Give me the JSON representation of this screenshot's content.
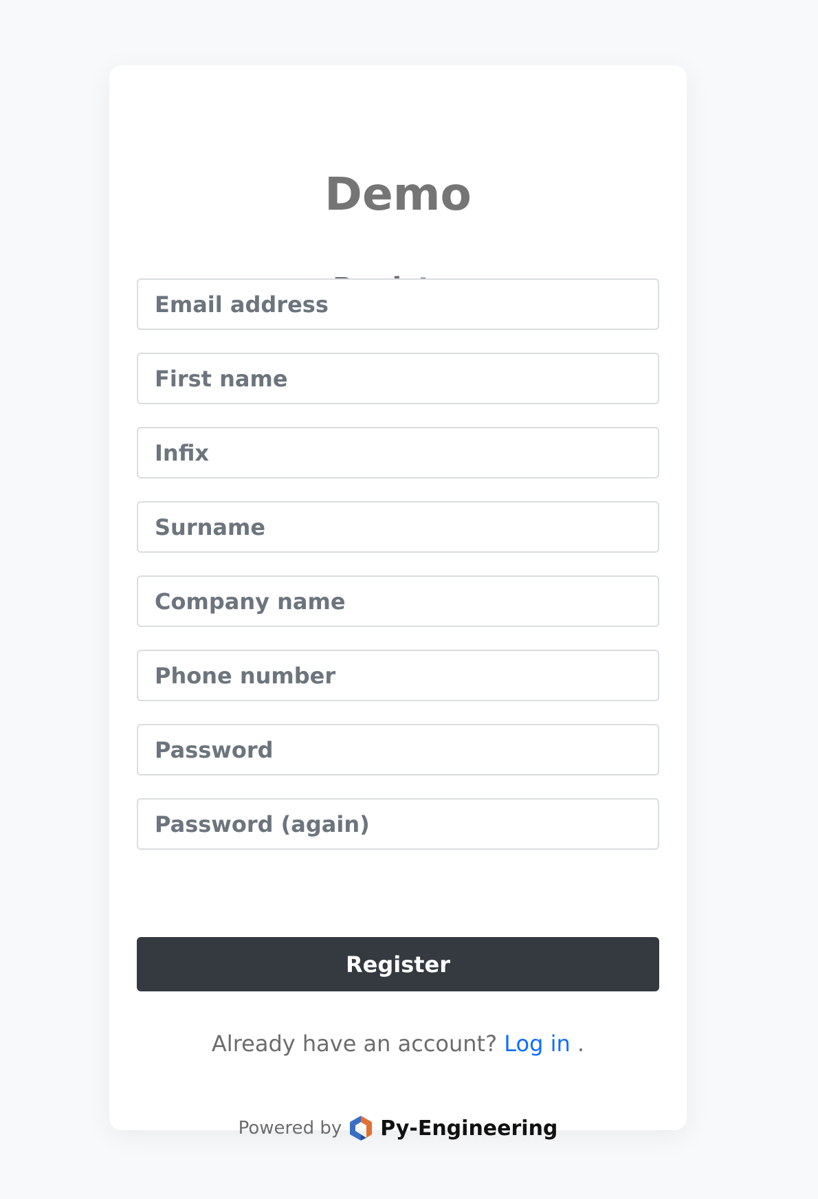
{
  "app": {
    "title": "Demo",
    "form_heading": "Register"
  },
  "form": {
    "fields": [
      {
        "placeholder": "Email address",
        "value": ""
      },
      {
        "placeholder": "First name",
        "value": ""
      },
      {
        "placeholder": "Infix",
        "value": ""
      },
      {
        "placeholder": "Surname",
        "value": ""
      },
      {
        "placeholder": "Company name",
        "value": ""
      },
      {
        "placeholder": "Phone number",
        "value": ""
      },
      {
        "placeholder": "Password",
        "value": ""
      },
      {
        "placeholder": "Password (again)",
        "value": ""
      }
    ],
    "submit_label": "Register"
  },
  "login": {
    "prompt": "Already have an account?",
    "link_label": "Log in",
    "suffix": "."
  },
  "footer": {
    "powered_label": "Powered by",
    "brand_name": "Py-Engineering",
    "brand_icon": "py-engineering-logo-icon"
  },
  "colors": {
    "background": "#f8f9fa",
    "button": "#343a40",
    "link": "#0d6efd",
    "logo_orange": "#e07030",
    "logo_blue": "#3a6ec4"
  }
}
